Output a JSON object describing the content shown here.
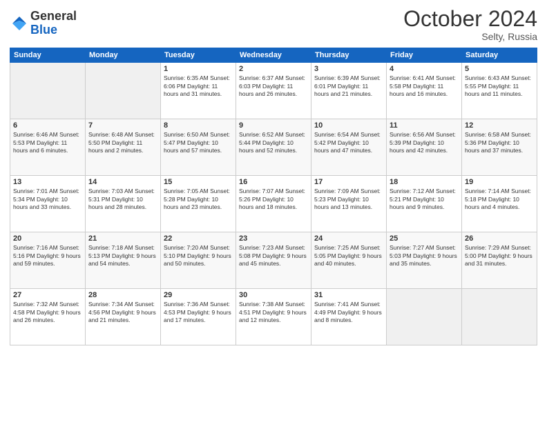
{
  "header": {
    "logo_line1": "General",
    "logo_line2": "Blue",
    "month": "October 2024",
    "location": "Selty, Russia"
  },
  "days_of_week": [
    "Sunday",
    "Monday",
    "Tuesday",
    "Wednesday",
    "Thursday",
    "Friday",
    "Saturday"
  ],
  "weeks": [
    [
      {
        "day": "",
        "info": ""
      },
      {
        "day": "",
        "info": ""
      },
      {
        "day": "1",
        "info": "Sunrise: 6:35 AM\nSunset: 6:06 PM\nDaylight: 11 hours and 31 minutes."
      },
      {
        "day": "2",
        "info": "Sunrise: 6:37 AM\nSunset: 6:03 PM\nDaylight: 11 hours and 26 minutes."
      },
      {
        "day": "3",
        "info": "Sunrise: 6:39 AM\nSunset: 6:01 PM\nDaylight: 11 hours and 21 minutes."
      },
      {
        "day": "4",
        "info": "Sunrise: 6:41 AM\nSunset: 5:58 PM\nDaylight: 11 hours and 16 minutes."
      },
      {
        "day": "5",
        "info": "Sunrise: 6:43 AM\nSunset: 5:55 PM\nDaylight: 11 hours and 11 minutes."
      }
    ],
    [
      {
        "day": "6",
        "info": "Sunrise: 6:46 AM\nSunset: 5:53 PM\nDaylight: 11 hours and 6 minutes."
      },
      {
        "day": "7",
        "info": "Sunrise: 6:48 AM\nSunset: 5:50 PM\nDaylight: 11 hours and 2 minutes."
      },
      {
        "day": "8",
        "info": "Sunrise: 6:50 AM\nSunset: 5:47 PM\nDaylight: 10 hours and 57 minutes."
      },
      {
        "day": "9",
        "info": "Sunrise: 6:52 AM\nSunset: 5:44 PM\nDaylight: 10 hours and 52 minutes."
      },
      {
        "day": "10",
        "info": "Sunrise: 6:54 AM\nSunset: 5:42 PM\nDaylight: 10 hours and 47 minutes."
      },
      {
        "day": "11",
        "info": "Sunrise: 6:56 AM\nSunset: 5:39 PM\nDaylight: 10 hours and 42 minutes."
      },
      {
        "day": "12",
        "info": "Sunrise: 6:58 AM\nSunset: 5:36 PM\nDaylight: 10 hours and 37 minutes."
      }
    ],
    [
      {
        "day": "13",
        "info": "Sunrise: 7:01 AM\nSunset: 5:34 PM\nDaylight: 10 hours and 33 minutes."
      },
      {
        "day": "14",
        "info": "Sunrise: 7:03 AM\nSunset: 5:31 PM\nDaylight: 10 hours and 28 minutes."
      },
      {
        "day": "15",
        "info": "Sunrise: 7:05 AM\nSunset: 5:28 PM\nDaylight: 10 hours and 23 minutes."
      },
      {
        "day": "16",
        "info": "Sunrise: 7:07 AM\nSunset: 5:26 PM\nDaylight: 10 hours and 18 minutes."
      },
      {
        "day": "17",
        "info": "Sunrise: 7:09 AM\nSunset: 5:23 PM\nDaylight: 10 hours and 13 minutes."
      },
      {
        "day": "18",
        "info": "Sunrise: 7:12 AM\nSunset: 5:21 PM\nDaylight: 10 hours and 9 minutes."
      },
      {
        "day": "19",
        "info": "Sunrise: 7:14 AM\nSunset: 5:18 PM\nDaylight: 10 hours and 4 minutes."
      }
    ],
    [
      {
        "day": "20",
        "info": "Sunrise: 7:16 AM\nSunset: 5:16 PM\nDaylight: 9 hours and 59 minutes."
      },
      {
        "day": "21",
        "info": "Sunrise: 7:18 AM\nSunset: 5:13 PM\nDaylight: 9 hours and 54 minutes."
      },
      {
        "day": "22",
        "info": "Sunrise: 7:20 AM\nSunset: 5:10 PM\nDaylight: 9 hours and 50 minutes."
      },
      {
        "day": "23",
        "info": "Sunrise: 7:23 AM\nSunset: 5:08 PM\nDaylight: 9 hours and 45 minutes."
      },
      {
        "day": "24",
        "info": "Sunrise: 7:25 AM\nSunset: 5:05 PM\nDaylight: 9 hours and 40 minutes."
      },
      {
        "day": "25",
        "info": "Sunrise: 7:27 AM\nSunset: 5:03 PM\nDaylight: 9 hours and 35 minutes."
      },
      {
        "day": "26",
        "info": "Sunrise: 7:29 AM\nSunset: 5:00 PM\nDaylight: 9 hours and 31 minutes."
      }
    ],
    [
      {
        "day": "27",
        "info": "Sunrise: 7:32 AM\nSunset: 4:58 PM\nDaylight: 9 hours and 26 minutes."
      },
      {
        "day": "28",
        "info": "Sunrise: 7:34 AM\nSunset: 4:56 PM\nDaylight: 9 hours and 21 minutes."
      },
      {
        "day": "29",
        "info": "Sunrise: 7:36 AM\nSunset: 4:53 PM\nDaylight: 9 hours and 17 minutes."
      },
      {
        "day": "30",
        "info": "Sunrise: 7:38 AM\nSunset: 4:51 PM\nDaylight: 9 hours and 12 minutes."
      },
      {
        "day": "31",
        "info": "Sunrise: 7:41 AM\nSunset: 4:49 PM\nDaylight: 9 hours and 8 minutes."
      },
      {
        "day": "",
        "info": ""
      },
      {
        "day": "",
        "info": ""
      }
    ]
  ]
}
